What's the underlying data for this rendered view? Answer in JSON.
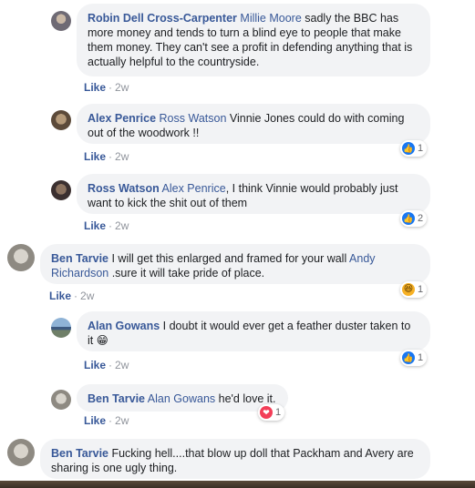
{
  "comments": [
    {
      "author": "Robin Dell Cross-Carpenter",
      "mention": "Millie Moore",
      "text": " sadly the BBC has more money and tends to turn a blind eye to people that make them money. They can't see a profit in defending anything that is actually helpful to the countryside.",
      "like_label": "Like",
      "time": "2w"
    },
    {
      "author": "Alex Penrice",
      "mention": "Ross Watson",
      "text": " Vinnie Jones could do with coming out of the woodwork !!",
      "like_label": "Like",
      "time": "2w",
      "reaction": {
        "type": "like",
        "count": "1"
      }
    },
    {
      "author": "Ross Watson",
      "mention": "Alex Penrice",
      "text": ", I think Vinnie would probably just want to kick the shit out of them",
      "like_label": "Like",
      "time": "2w",
      "reaction": {
        "type": "like",
        "count": "2"
      }
    },
    {
      "author": "Ben Tarvie",
      "text_before": " I will get this enlarged and framed for your wall ",
      "mention": "Andy Richardson",
      "text_after": " .sure it will take pride of place.",
      "like_label": "Like",
      "time": "2w",
      "reaction": {
        "type": "haha",
        "count": "1"
      }
    },
    {
      "author": "Alan Gowans",
      "text": " I doubt it would ever get a feather duster taken to it ",
      "emoji": "😁",
      "like_label": "Like",
      "time": "2w",
      "reaction": {
        "type": "like",
        "count": "1"
      }
    },
    {
      "author": "Ben Tarvie",
      "mention": "Alan Gowans",
      "text": " he'd love it.",
      "like_label": "Like",
      "time": "2w",
      "reaction": {
        "type": "love",
        "count": "1"
      }
    },
    {
      "author": "Ben Tarvie",
      "text": " Fucking hell....that blow up doll that Packham and Avery are sharing is one ugly thing."
    }
  ],
  "separator": "·",
  "colors": {
    "link": "#385898",
    "bubble": "#f2f3f5",
    "like_blue": "#1877f2",
    "love_red": "#f33e58",
    "haha_yellow": "#f7b125"
  },
  "icons": {
    "like": "thumbs-up-icon",
    "love": "heart-icon",
    "haha": "laughing-face-icon"
  }
}
